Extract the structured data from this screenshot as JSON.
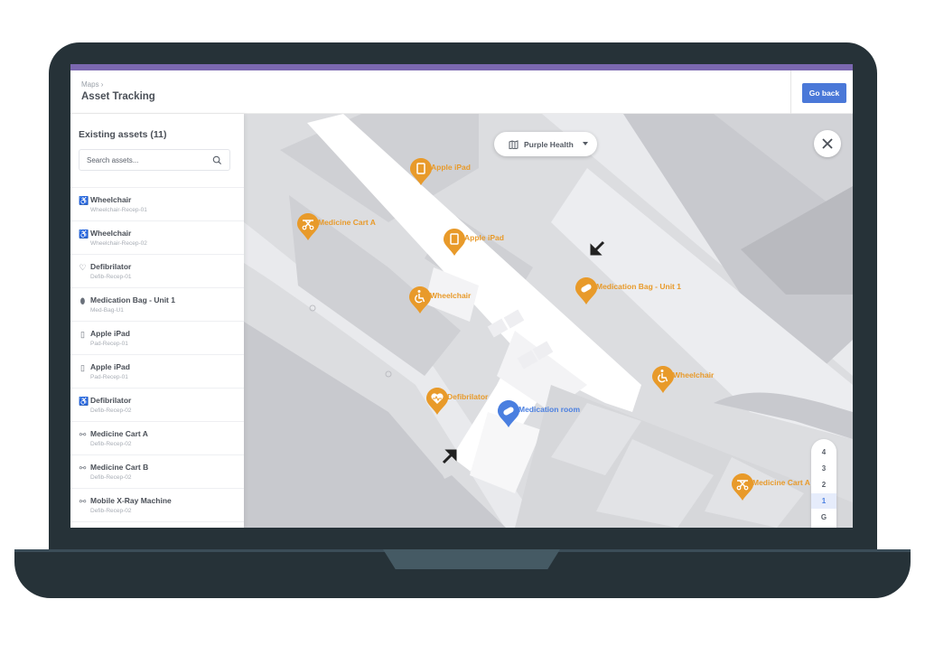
{
  "header": {
    "breadcrumb": "Maps ›",
    "title": "Asset Tracking",
    "go_back_label": "Go back"
  },
  "sidebar": {
    "title": "Existing assets (11)",
    "search_placeholder": "Search assets...",
    "items": [
      {
        "icon": "wheelchair-icon",
        "glyph": "♿",
        "name": "Wheelchair",
        "id": "Wheelchair-Recep-01"
      },
      {
        "icon": "wheelchair-icon",
        "glyph": "♿",
        "name": "Wheelchair",
        "id": "Wheelchair-Recep-02"
      },
      {
        "icon": "heart-pulse-icon",
        "glyph": "♡",
        "name": "Defibrilator",
        "id": "Defib-Recep-01"
      },
      {
        "icon": "pill-icon",
        "glyph": "⬮",
        "name": "Medication Bag - Unit 1",
        "id": "Med-Bag-U1"
      },
      {
        "icon": "tablet-icon",
        "glyph": "▯",
        "name": "Apple iPad",
        "id": "Pad-Recep-01"
      },
      {
        "icon": "tablet-icon",
        "glyph": "▯",
        "name": "Apple iPad",
        "id": "Pad-Recep-01"
      },
      {
        "icon": "wheelchair-icon",
        "glyph": "♿",
        "name": "Defibrilator",
        "id": "Defib-Recep-02"
      },
      {
        "icon": "cart-icon",
        "glyph": "⚯",
        "name": "Medicine Cart A",
        "id": "Defib-Recep-02"
      },
      {
        "icon": "cart-icon",
        "glyph": "⚯",
        "name": "Medicine Cart B",
        "id": "Defib-Recep-02"
      },
      {
        "icon": "cart-icon",
        "glyph": "⚯",
        "name": "Mobile X-Ray Machine",
        "id": "Defib-Recep-02"
      }
    ]
  },
  "map": {
    "venue_selector": "Purple Health",
    "floors": [
      "4",
      "3",
      "2",
      "1",
      "G"
    ],
    "active_floor": "1",
    "pins": [
      {
        "label": "Apple iPad",
        "type": "tablet",
        "color": "#e89a2a"
      },
      {
        "label": "Medicine Cart A",
        "type": "cart",
        "color": "#e89a2a"
      },
      {
        "label": "Apple iPad",
        "type": "tablet",
        "color": "#e89a2a"
      },
      {
        "label": "Wheelchair",
        "type": "wheelchair",
        "color": "#e89a2a"
      },
      {
        "label": "Medication Bag - Unit 1",
        "type": "pill",
        "color": "#e89a2a"
      },
      {
        "label": "Wheelchair",
        "type": "wheelchair",
        "color": "#e89a2a"
      },
      {
        "label": "Defibrilator",
        "type": "heart",
        "color": "#e89a2a"
      },
      {
        "label": "Medication room",
        "type": "pill",
        "color": "#4a7fe0"
      },
      {
        "label": "Medicine Cart A",
        "type": "cart",
        "color": "#e89a2a"
      }
    ]
  },
  "colors": {
    "accent_bar": "#7b68b0",
    "primary_button": "#4a78d8",
    "asset_pin": "#e89a2a",
    "room_pin": "#4a7fe0",
    "laptop_body": "#263238"
  }
}
